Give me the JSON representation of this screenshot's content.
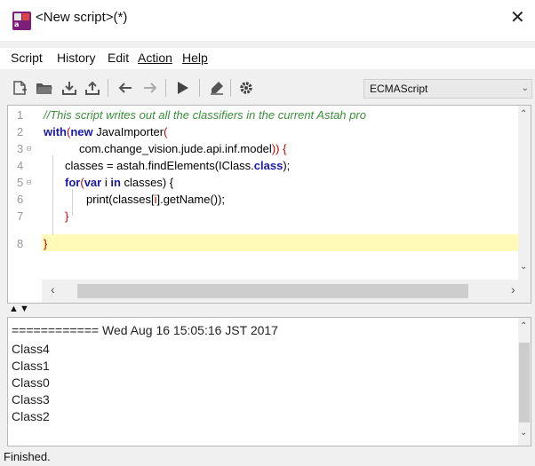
{
  "window": {
    "title": "<New script>(*)",
    "close_glyph": "✕",
    "app_icon": "astah-icon"
  },
  "menu": {
    "script": "Script",
    "history": "History",
    "edit": "Edit",
    "action": "Action",
    "help": "Help"
  },
  "toolbar": {
    "icons": [
      "new-script-icon",
      "open-folder-icon",
      "download-icon",
      "upload-icon",
      "undo-icon",
      "redo-icon",
      "run-icon",
      "clear-output-icon",
      "settings-icon"
    ],
    "language": "ECMAScript"
  },
  "editor": {
    "line_numbers": [
      "1",
      "2",
      "3",
      "4",
      "5",
      "6",
      "7",
      "8"
    ],
    "lines": {
      "l1": "//This script writes out all the classifiers in the current Astah pro",
      "l2_kw1": "with",
      "l2_a": "(",
      "l2_kw2": "new",
      "l2_b": " JavaImporter",
      "l2_c": "(",
      "l3": "com.change_vision.jude.api.inf.model",
      "l3_end": ")) {",
      "l4_a": "classes = astah.findElements(IClass.",
      "l4_kw": "class",
      "l4_b": ");",
      "l5_kw1": "for",
      "l5_a": "(",
      "l5_kw2": "var",
      "l5_b": " i ",
      "l5_kw3": "in",
      "l5_c": " classes) {",
      "l6_a": "print(classes[",
      "l6_i": "i",
      "l6_b": "].getName());",
      "l7": "}",
      "l8": "}"
    },
    "highlight_color": "#fffab8",
    "keyword_color": "#1a1aa6",
    "comment_color": "#3b8f3b"
  },
  "output": {
    "lines": [
      "============ Wed Aug 16 15:05:16 JST 2017",
      "Class4",
      "Class1",
      "Class0",
      "Class3",
      "Class2"
    ]
  },
  "status": "Finished."
}
